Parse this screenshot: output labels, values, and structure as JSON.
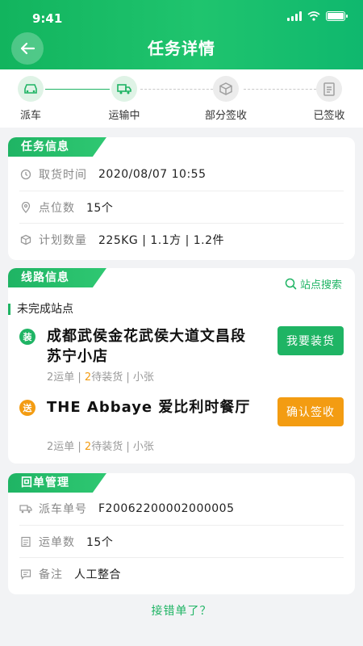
{
  "status_bar": {
    "time": "9:41"
  },
  "header": {
    "title": "任务详情"
  },
  "steps": [
    {
      "label": "派车",
      "state": "done"
    },
    {
      "label": "运输中",
      "state": "active"
    },
    {
      "label": "部分签收",
      "state": "pending"
    },
    {
      "label": "已签收",
      "state": "pending"
    }
  ],
  "task_info": {
    "tag": "任务信息",
    "rows": [
      {
        "label": "取货时间",
        "value": "2020/08/07 10:55",
        "icon": "clock-icon"
      },
      {
        "label": "点位数",
        "value": "15个",
        "icon": "location-pin-icon"
      },
      {
        "label": "计划数量",
        "value": "225KG | 1.1方 | 1.2件",
        "icon": "box-icon"
      }
    ]
  },
  "route_info": {
    "tag": "线路信息",
    "search_label": "站点搜索",
    "subheading": "未完成站点",
    "stops": [
      {
        "badge": "装",
        "badge_color": "#1fb464",
        "name": "成都武侯金花武侯大道文昌段苏宁小店",
        "meta_prefix": "2运单 | ",
        "meta_num": "2",
        "meta_suffix": "待装货 | 小张",
        "button": "我要装货",
        "button_color": "#1fb464"
      },
      {
        "badge": "送",
        "badge_color": "#f39c12",
        "name": "THE  Abbaye 爱比利时餐厅",
        "meta_prefix": "2运单 | ",
        "meta_num": "2",
        "meta_suffix": "待装货 | 小张",
        "button": "确认签收",
        "button_color": "#f39c12"
      }
    ]
  },
  "receipt": {
    "tag": "回单管理",
    "rows": [
      {
        "label": "派车单号",
        "value": "F20062200002000005",
        "icon": "truck-icon"
      },
      {
        "label": "运单数",
        "value": "15个",
        "icon": "document-icon"
      },
      {
        "label": "备注",
        "value": "人工整合",
        "icon": "note-icon"
      }
    ]
  },
  "footer": {
    "link": "接错单了？"
  },
  "colors": {
    "primary": "#1fb464",
    "accent": "#f39c12"
  }
}
